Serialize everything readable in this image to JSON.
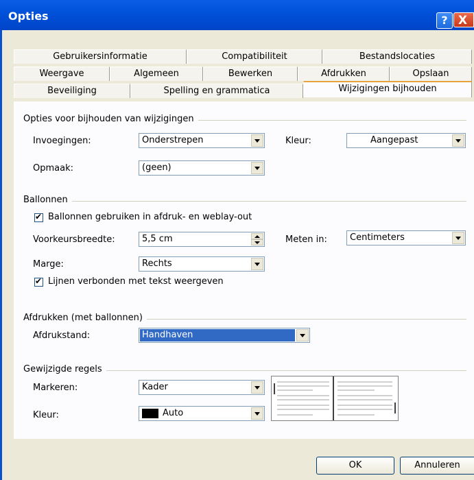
{
  "window": {
    "title": "Opties",
    "help": "?",
    "close": "X"
  },
  "tabs": {
    "row1": [
      "Gebruikersinformatie",
      "Compatibiliteit",
      "Bestandslocaties"
    ],
    "row2": [
      "Weergave",
      "Algemeen",
      "Bewerken",
      "Afdrukken",
      "Opslaan"
    ],
    "row3": [
      "Beveiliging",
      "Spelling en grammatica",
      "Wijzigingen bijhouden"
    ],
    "selected": "Wijzigingen bijhouden"
  },
  "track": {
    "heading": "Opties voor bijhouden van wijzigingen",
    "insertions_label": "Invoegingen:",
    "insertions_value": "Onderstrepen",
    "color_label": "Kleur:",
    "color_value": "Aangepast",
    "format_label": "Opmaak:",
    "format_value": "(geen)"
  },
  "balloons": {
    "heading": "Ballonnen",
    "use_label": "Ballonnen gebruiken in afdruk- en weblay-out",
    "use_checked": true,
    "width_label": "Voorkeursbreedte:",
    "width_value": "5,5 cm",
    "measure_label": "Meten in:",
    "measure_value": "Centimeters",
    "margin_label": "Marge:",
    "margin_value": "Rechts",
    "lines_label": "Lijnen verbonden met tekst weergeven",
    "lines_checked": true
  },
  "printing": {
    "heading": "Afdrukken (met ballonnen)",
    "orientation_label": "Afdrukstand:",
    "orientation_value": "Handhaven"
  },
  "changed": {
    "heading": "Gewijzigde regels",
    "mark_label": "Markeren:",
    "mark_value": "Kader",
    "color_label": "Kleur:",
    "color_value": "Auto",
    "color_swatch": "#000000"
  },
  "buttons": {
    "ok": "OK",
    "cancel": "Annuleren"
  }
}
